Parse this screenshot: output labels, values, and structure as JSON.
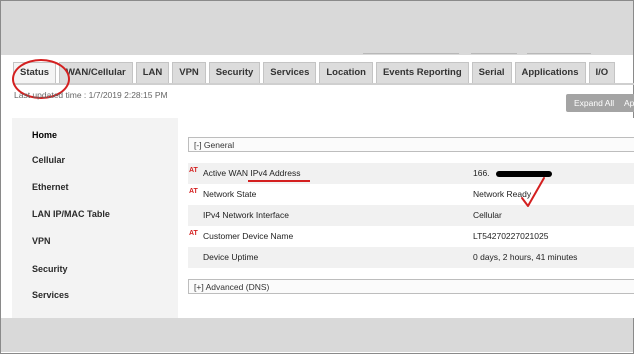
{
  "tabs": [
    {
      "label": "Status",
      "active": true
    },
    {
      "label": "WAN/Cellular"
    },
    {
      "label": "LAN"
    },
    {
      "label": "VPN"
    },
    {
      "label": "Security"
    },
    {
      "label": "Services"
    },
    {
      "label": "Location"
    },
    {
      "label": "Events Reporting"
    },
    {
      "label": "Serial"
    },
    {
      "label": "Applications"
    },
    {
      "label": "I/O"
    }
  ],
  "last_updated": "Last updated time : 1/7/2019 2:28:15 PM",
  "buttons": {
    "expand_all": "Expand All",
    "apply_partial": "Ap"
  },
  "sidebar": {
    "items": [
      {
        "label": "Home",
        "active": true
      },
      {
        "label": "Cellular"
      },
      {
        "label": "Ethernet"
      },
      {
        "label": "LAN IP/MAC Table"
      },
      {
        "label": "VPN"
      },
      {
        "label": "Security"
      },
      {
        "label": "Services"
      }
    ]
  },
  "sections": {
    "general": "[-] General",
    "advanced": "[+] Advanced (DNS)"
  },
  "at_marker": "AT",
  "rows": [
    {
      "label": "Active WAN IPv4 Address",
      "value": "166.",
      "at": true,
      "redacted": true
    },
    {
      "label": "Network State",
      "value": "Network Ready",
      "at": true
    },
    {
      "label": "IPv4 Network Interface",
      "value": "Cellular",
      "at": false
    },
    {
      "label": "Customer Device Name",
      "value": "LT54270227021025",
      "at": true
    },
    {
      "label": "Device Uptime",
      "value": "0 days, 2 hours, 41 minutes",
      "at": false
    }
  ],
  "colors": {
    "annotation_red": "#d42020",
    "top_bar": "#d9d9d9",
    "sidebar_bg": "#f3f3f3",
    "button_bg": "#a4a4a4"
  }
}
